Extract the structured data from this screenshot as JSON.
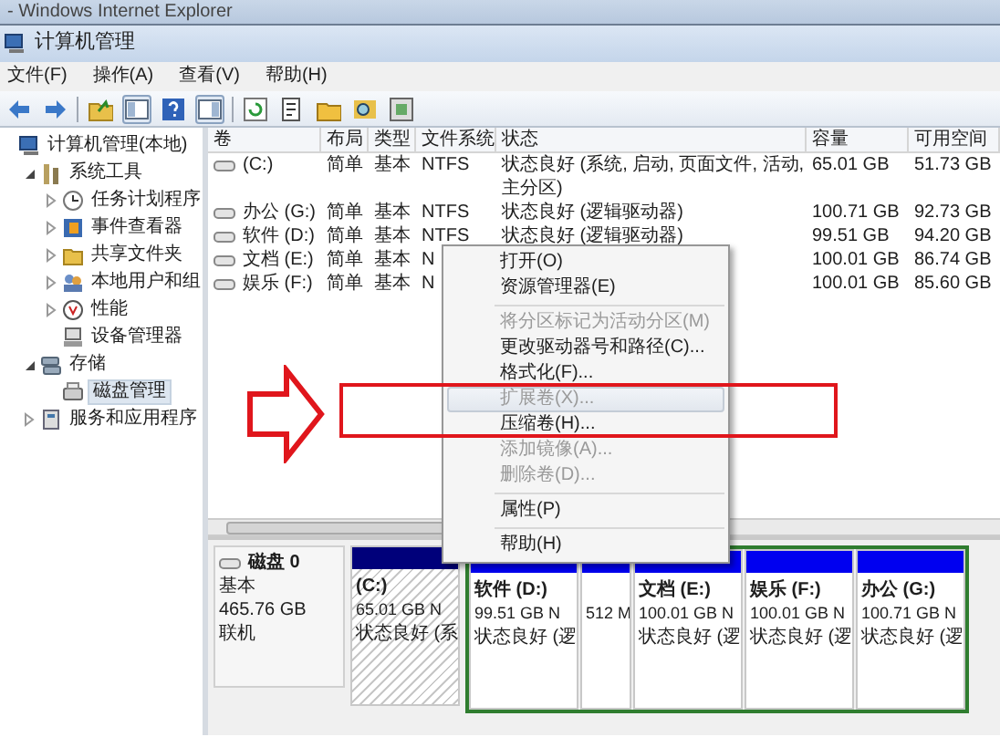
{
  "browser_window": {
    "title": "- Windows Internet Explorer"
  },
  "window": {
    "title": "计算机管理"
  },
  "menu": [
    "文件(F)",
    "操作(A)",
    "查看(V)",
    "帮助(H)"
  ],
  "tree": [
    {
      "label": "计算机管理(本地)",
      "kind": "computer",
      "selected": false,
      "children": [
        {
          "label": "系统工具",
          "kind": "tools",
          "expanded": true,
          "selected": false,
          "children": [
            {
              "label": "任务计划程序",
              "kind": "clock",
              "expanded": false,
              "selected": false
            },
            {
              "label": "事件查看器",
              "kind": "log",
              "expanded": false,
              "selected": false
            },
            {
              "label": "共享文件夹",
              "kind": "folder",
              "expanded": false,
              "selected": false
            },
            {
              "label": "本地用户和组",
              "kind": "users",
              "expanded": false,
              "selected": false
            },
            {
              "label": "性能",
              "kind": "gauge",
              "expanded": false,
              "selected": false
            },
            {
              "label": "设备管理器",
              "kind": "device",
              "selected": false
            }
          ]
        },
        {
          "label": "存储",
          "kind": "storage",
          "expanded": true,
          "selected": false,
          "children": [
            {
              "label": "磁盘管理",
              "kind": "disk",
              "selected": true
            }
          ]
        },
        {
          "label": "服务和应用程序",
          "kind": "services",
          "expanded": false,
          "selected": false
        }
      ]
    }
  ],
  "table": {
    "columns": [
      "卷",
      "布局",
      "类型",
      "文件系统",
      "状态",
      "容量",
      "可用空间"
    ],
    "rows": [
      {
        "volume": "(C:)",
        "layout": "简单",
        "type": "基本",
        "file_system": "NTFS",
        "status": "状态良好 (系统, 启动, 页面文件, 活动, 主分区)",
        "capacity": "65.01 GB",
        "free_space": "51.73 GB"
      },
      {
        "volume": "办公 (G:)",
        "layout": "简单",
        "type": "基本",
        "file_system": "NTFS",
        "status": "状态良好 (逻辑驱动器)",
        "capacity": "100.71 GB",
        "free_space": "92.73 GB"
      },
      {
        "volume": "软件 (D:)",
        "layout": "简单",
        "type": "基本",
        "file_system": "NTFS",
        "status": "状态良好 (逻辑驱动器)",
        "capacity": "99.51 GB",
        "free_space": "94.20 GB"
      },
      {
        "volume": "文档 (E:)",
        "layout": "简单",
        "type": "基本",
        "file_system": "N",
        "capacity": "100.01 GB",
        "free_space": "86.74 GB"
      },
      {
        "volume": "娱乐 (F:)",
        "layout": "简单",
        "type": "基本",
        "file_system": "N",
        "capacity": "100.01 GB",
        "free_space": "85.60 GB"
      }
    ]
  },
  "context_menu": {
    "items": [
      {
        "kind": "item",
        "label": "打开(O)",
        "disabled": false,
        "selected": false
      },
      {
        "kind": "item",
        "label": "资源管理器(E)",
        "disabled": false,
        "selected": false
      },
      {
        "kind": "separator"
      },
      {
        "kind": "item",
        "label": "将分区标记为活动分区(M)",
        "disabled": true,
        "selected": false
      },
      {
        "kind": "item",
        "label": "更改驱动器号和路径(C)...",
        "disabled": false,
        "selected": false
      },
      {
        "kind": "item",
        "label": "格式化(F)...",
        "disabled": false,
        "selected": false
      },
      {
        "kind": "item",
        "label": "扩展卷(X)...",
        "disabled": true,
        "selected": true
      },
      {
        "kind": "item",
        "label": "压缩卷(H)...",
        "disabled": false,
        "selected": false
      },
      {
        "kind": "item",
        "label": "添加镜像(A)...",
        "disabled": true,
        "selected": false
      },
      {
        "kind": "item",
        "label": "删除卷(D)...",
        "disabled": true,
        "selected": false
      },
      {
        "kind": "separator"
      },
      {
        "kind": "item",
        "label": "属性(P)",
        "disabled": false,
        "selected": false
      },
      {
        "kind": "separator"
      },
      {
        "kind": "item",
        "label": "帮助(H)",
        "disabled": false,
        "selected": false
      }
    ]
  },
  "disk_map": {
    "disk": {
      "name": "磁盘 0",
      "type": "基本",
      "size": "465.76 GB",
      "status": "联机"
    },
    "partitions": [
      {
        "kind": "primary",
        "label": "(C:)",
        "size": "65.01 GB N",
        "status": "状态良好 (系",
        "selected": true
      },
      {
        "kind": "logical",
        "label": "软件 (D:)",
        "size": "99.51 GB N",
        "status": "状态良好 (逻",
        "selected": false
      },
      {
        "kind": "logical",
        "size": "512 M",
        "selected": false
      },
      {
        "kind": "logical",
        "label": "文档 (E:)",
        "size": "100.01 GB N",
        "status": "状态良好 (逻",
        "selected": false
      },
      {
        "kind": "logical",
        "label": "娱乐 (F:)",
        "size": "100.01 GB N",
        "status": "状态良好 (逻",
        "selected": false
      },
      {
        "kind": "logical",
        "label": "办公 (G:)",
        "size": "100.71 GB N",
        "status": "状态良好 (逻",
        "selected": false
      }
    ]
  }
}
